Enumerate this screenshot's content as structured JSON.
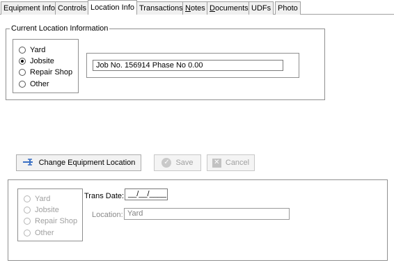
{
  "tabs": [
    {
      "label": "Equipment Info",
      "active": false
    },
    {
      "label": "Controls",
      "active": false
    },
    {
      "label": "Location Info",
      "active": true
    },
    {
      "label": "Transactions",
      "active": false
    },
    {
      "label": "Notes",
      "active": false
    },
    {
      "label": "Documents",
      "active": false
    },
    {
      "label": "UDFs",
      "active": false
    },
    {
      "label": "Photo",
      "active": false
    }
  ],
  "current_location": {
    "legend": "Current Location Information",
    "options": [
      "Yard",
      "Jobsite",
      "Repair Shop",
      "Other"
    ],
    "selected": "Jobsite",
    "detail_value": "Job No. 156914 Phase No 0.00"
  },
  "actions": {
    "change_label": "Change Equipment Location",
    "save_label": "Save",
    "cancel_label": "Cancel"
  },
  "change_form": {
    "options": [
      "Yard",
      "Jobsite",
      "Repair Shop",
      "Other"
    ],
    "trans_date_label": "Trans Date:",
    "trans_date_value": "__/__/____",
    "location_label": "Location:",
    "location_value": "Yard"
  }
}
